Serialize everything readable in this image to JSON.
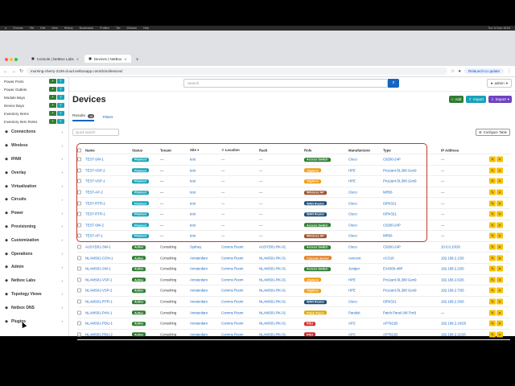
{
  "menubar": {
    "items": [
      "Chrome",
      "File",
      "Edit",
      "View",
      "History",
      "Bookmarks",
      "Profiles",
      "Tab",
      "Window",
      "Help"
    ],
    "clock": "Tue 14 Nov 18:53"
  },
  "browser": {
    "tabs": [
      {
        "label": "Console | NetBox Labs",
        "active": false
      },
      {
        "label": "Devices | NetBox",
        "active": true
      }
    ],
    "url": "morning-cherry-2109.cloud.netboxapp.com/dcim/devices/",
    "relaunch_label": "Relaunch to update"
  },
  "sidebar": {
    "subitems": [
      "Power Ports",
      "Power Outlets",
      "Module Bays",
      "Device Bays",
      "Inventory Items",
      "Inventory Item Roles"
    ],
    "sections": [
      {
        "label": "Connections",
        "icon": "connections-icon"
      },
      {
        "label": "Wireless",
        "icon": "wireless-icon"
      },
      {
        "label": "IPAM",
        "icon": "ipam-icon"
      },
      {
        "label": "Overlay",
        "icon": "overlay-icon"
      },
      {
        "label": "Virtualization",
        "icon": "virtualization-icon"
      },
      {
        "label": "Circuits",
        "icon": "circuits-icon"
      },
      {
        "label": "Power",
        "icon": "power-icon"
      },
      {
        "label": "Provisioning",
        "icon": "provisioning-icon"
      },
      {
        "label": "Customization",
        "icon": "customization-icon"
      },
      {
        "label": "Operations",
        "icon": "operations-icon"
      },
      {
        "label": "Admin",
        "icon": "admin-icon"
      },
      {
        "label": "Netbox Labs",
        "icon": "netbox-labs-icon"
      },
      {
        "label": "Topology Views",
        "icon": "topology-icon"
      },
      {
        "label": "Netbox DNS",
        "icon": "dns-icon"
      },
      {
        "label": "Plugins",
        "icon": "plugins-icon"
      }
    ]
  },
  "topbar": {
    "search_placeholder": "Search",
    "user": "admin"
  },
  "page": {
    "title": "Devices",
    "add_label": "Add",
    "import_label": "Import",
    "export_label": "Export",
    "results_label": "Results",
    "results_count": "16",
    "filters_label": "Filters",
    "quick_search_placeholder": "Quick search",
    "configure_table_label": "Configure Table"
  },
  "table": {
    "headers": {
      "name": "Name",
      "status": "Status",
      "tenant": "Tenant",
      "site": "Site",
      "location": "Location",
      "rack": "Rack",
      "role": "Role",
      "manufacturer": "Manufacturer",
      "type": "Type",
      "ip": "IP Address"
    },
    "rows": [
      {
        "name": "TEST-SW-1",
        "status": "Planned",
        "tenant": "—",
        "site": "test",
        "location": "—",
        "rack": "—",
        "role": "Access Switch",
        "manufacturer": "Cisco",
        "type": "C9200-24P",
        "ip": "—"
      },
      {
        "name": "TEST-VSP-2",
        "status": "Planned",
        "tenant": "—",
        "site": "test",
        "location": "—",
        "rack": "—",
        "role": "vSphere",
        "manufacturer": "HPE",
        "type": "ProLiant DL380 Gen9",
        "ip": "—"
      },
      {
        "name": "TEST-VSP-1",
        "status": "Planned",
        "tenant": "—",
        "site": "test",
        "location": "—",
        "rack": "—",
        "role": "vSphere",
        "manufacturer": "HPE",
        "type": "ProLiant DL380 Gen9",
        "ip": "—"
      },
      {
        "name": "TEST-AP-2",
        "status": "Planned",
        "tenant": "—",
        "site": "test",
        "location": "—",
        "rack": "—",
        "role": "Wireless AP",
        "manufacturer": "Cisco",
        "type": "MR56",
        "ip": "—"
      },
      {
        "name": "TEST-RTR-2",
        "status": "Planned",
        "tenant": "—",
        "site": "test",
        "location": "—",
        "rack": "—",
        "role": "WAN Router",
        "manufacturer": "Cisco",
        "type": "ISR4321",
        "ip": "—"
      },
      {
        "name": "TEST-RTR-1",
        "status": "Planned",
        "tenant": "—",
        "site": "test",
        "location": "—",
        "rack": "—",
        "role": "WAN Router",
        "manufacturer": "Cisco",
        "type": "ISR4321",
        "ip": "—"
      },
      {
        "name": "TEST-SW-2",
        "status": "Planned",
        "tenant": "—",
        "site": "test",
        "location": "—",
        "rack": "—",
        "role": "Access Switch",
        "manufacturer": "Cisco",
        "type": "C9200-24P",
        "ip": "—"
      },
      {
        "name": "TEST-AP-1",
        "status": "Planned",
        "tenant": "—",
        "site": "test",
        "location": "—",
        "rack": "—",
        "role": "Wireless AP",
        "manufacturer": "Cisco",
        "type": "MR56",
        "ip": "—"
      },
      {
        "name": "AUSYD01-SW-1",
        "status": "Active",
        "tenant": "Consulting",
        "site": "Sydney",
        "location": "Comms Room",
        "rack": "AUSYD01-RK-01",
        "role": "Access Switch",
        "manufacturer": "Cisco",
        "type": "C9200-24P",
        "ip": "10.0.0.10/26"
      },
      {
        "name": "NLAMS01-CON-1",
        "status": "Active",
        "tenant": "Consulting",
        "site": "Amsterdam",
        "location": "Comms Room",
        "rack": "NLAMS01-RK-01",
        "role": "Console Server",
        "manufacturer": "Avocent",
        "type": "ACS16",
        "ip": "192.168.2.1/26"
      },
      {
        "name": "NLAMS01-SW-1",
        "status": "Active",
        "tenant": "Consulting",
        "site": "Amsterdam",
        "location": "Comms Room",
        "rack": "NLAMS01-RK-01",
        "role": "Access Switch",
        "manufacturer": "Juniper",
        "type": "EX4300-48P",
        "ip": "192.168.2.2/26"
      },
      {
        "name": "NLAMS01-VSP-1",
        "status": "Active",
        "tenant": "Consulting",
        "site": "Amsterdam",
        "location": "Comms Room",
        "rack": "NLAMS01-RK-01",
        "role": "vSphere",
        "manufacturer": "HPE",
        "type": "ProLiant DL380 Gen9",
        "ip": "192.168.2.6/26"
      },
      {
        "name": "NLAMS01-VSP-2",
        "status": "Active",
        "tenant": "Consulting",
        "site": "Amsterdam",
        "location": "Comms Room",
        "rack": "NLAMS01-RK-01",
        "role": "vSphere",
        "manufacturer": "HPE",
        "type": "ProLiant DL380 Gen9",
        "ip": "192.168.2.7/26"
      },
      {
        "name": "NLAMS01-RTR-1",
        "status": "Active",
        "tenant": "Consulting",
        "site": "Amsterdam",
        "location": "Comms Room",
        "rack": "NLAMS01-RK-01",
        "role": "WAN Router",
        "manufacturer": "Cisco",
        "type": "ISR4321",
        "ip": "192.168.2.3/26"
      },
      {
        "name": "NLAMS01-PAN-1",
        "status": "Active",
        "tenant": "Consulting",
        "site": "Amsterdam",
        "location": "Comms Room",
        "rack": "NLAMS01-RK-01",
        "role": "Patch Panel",
        "manufacturer": "Panduit",
        "type": "Patch Panel (48 Port)",
        "ip": "—"
      },
      {
        "name": "NLAMS01-PDU-1",
        "status": "Active",
        "tenant": "Consulting",
        "site": "Amsterdam",
        "location": "Comms Room",
        "rack": "NLAMS01-RK-01",
        "role": "PDU",
        "manufacturer": "APC",
        "type": "AP7921B",
        "ip": "192.168.2.10/26"
      },
      {
        "name": "NLAMS01-PDU-2",
        "status": "Active",
        "tenant": "Consulting",
        "site": "Amsterdam",
        "location": "Comms Room",
        "rack": "NLAMS01-RK-01",
        "role": "PDU",
        "manufacturer": "APC",
        "type": "AP7921B",
        "ip": "192.168.2.11/26"
      }
    ]
  },
  "colors": {
    "planned": "#17a2b8",
    "active": "#2e7d32",
    "roles": {
      "Access Switch": "#2e7d32",
      "vSphere": "#f39c12",
      "Wireless AP": "#a0522d",
      "WAN Router": "#1e4e79",
      "Console Server": "#e67e22",
      "Patch Panel": "#e0a800",
      "PDU": "#d32f2f"
    }
  }
}
